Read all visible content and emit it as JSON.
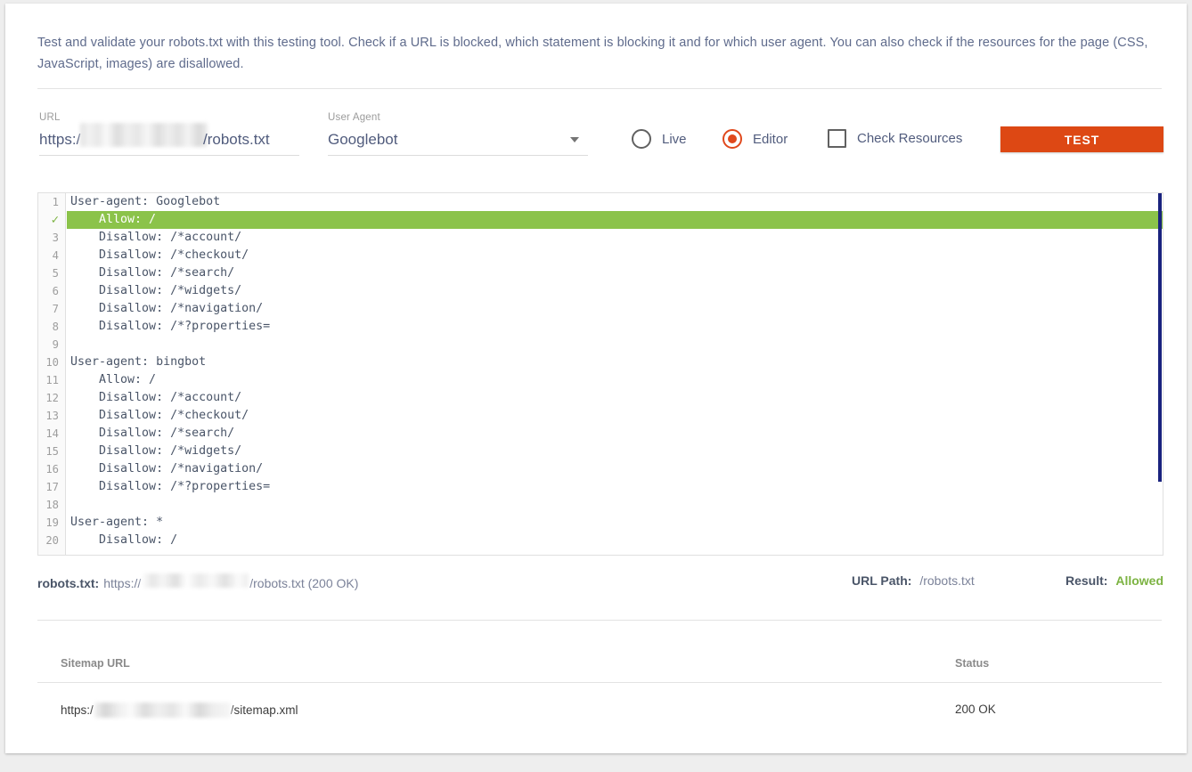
{
  "intro": {
    "text": "Test and validate your robots.txt with this testing tool. Check if a URL is blocked, which statement is blocking it and for which user agent. You can also check if the resources for the page (CSS, JavaScript, images) are disallowed."
  },
  "form": {
    "url_label": "URL",
    "url_prefix": "https:/",
    "url_suffix": "/robots.txt",
    "user_agent_label": "User Agent",
    "user_agent_value": "Googlebot",
    "radio_live_label": "Live",
    "radio_editor_label": "Editor",
    "checkbox_resources_label": "Check Resources",
    "test_button_label": "TEST",
    "selected_mode": "Editor",
    "accent_color": "#dd4814"
  },
  "editor": {
    "lines": [
      {
        "num": "1",
        "text": "User-agent: Googlebot",
        "highlight": false
      },
      {
        "num": "✓",
        "text": "    Allow: /",
        "highlight": true
      },
      {
        "num": "3",
        "text": "    Disallow: /*account/",
        "highlight": false
      },
      {
        "num": "4",
        "text": "    Disallow: /*checkout/",
        "highlight": false
      },
      {
        "num": "5",
        "text": "    Disallow: /*search/",
        "highlight": false
      },
      {
        "num": "6",
        "text": "    Disallow: /*widgets/",
        "highlight": false
      },
      {
        "num": "7",
        "text": "    Disallow: /*navigation/",
        "highlight": false
      },
      {
        "num": "8",
        "text": "    Disallow: /*?properties=",
        "highlight": false
      },
      {
        "num": "9",
        "text": "",
        "highlight": false
      },
      {
        "num": "10",
        "text": "User-agent: bingbot",
        "highlight": false
      },
      {
        "num": "11",
        "text": "    Allow: /",
        "highlight": false
      },
      {
        "num": "12",
        "text": "    Disallow: /*account/",
        "highlight": false
      },
      {
        "num": "13",
        "text": "    Disallow: /*checkout/",
        "highlight": false
      },
      {
        "num": "14",
        "text": "    Disallow: /*search/",
        "highlight": false
      },
      {
        "num": "15",
        "text": "    Disallow: /*widgets/",
        "highlight": false
      },
      {
        "num": "16",
        "text": "    Disallow: /*navigation/",
        "highlight": false
      },
      {
        "num": "17",
        "text": "    Disallow: /*?properties=",
        "highlight": false
      },
      {
        "num": "18",
        "text": "",
        "highlight": false
      },
      {
        "num": "19",
        "text": "User-agent: *",
        "highlight": false
      },
      {
        "num": "20",
        "text": "    Disallow: /",
        "highlight": false
      }
    ],
    "highlight_color": "#8bc34a",
    "scrollbar_color": "#1a237e"
  },
  "result": {
    "robots_label": "robots.txt:",
    "robots_url_prefix": "https://",
    "robots_url_suffix": "/robots.txt (200 OK)",
    "url_path_label": "URL Path:",
    "url_path_value": "/robots.txt",
    "result_label": "Result:",
    "result_value": "Allowed",
    "result_color": "#7cb342"
  },
  "sitemap_table": {
    "columns": [
      "Sitemap URL",
      "Status"
    ],
    "rows": [
      {
        "url_prefix": "https:/",
        "url_suffix": "/sitemap.xml",
        "status": "200 OK"
      }
    ]
  }
}
